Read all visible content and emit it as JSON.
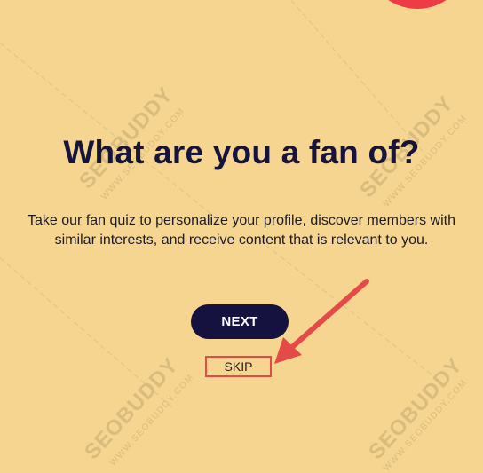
{
  "header": {
    "title": "What are you a fan of?"
  },
  "main": {
    "description": "Take our fan quiz to personalize your profile, discover members with similar interests, and receive content that is relevant to you."
  },
  "actions": {
    "next_label": "NEXT",
    "skip_label": "SKIP"
  },
  "watermark": {
    "brand": "SEOBUDDY",
    "domain": "WWW.SEOBUDDY.COM"
  },
  "colors": {
    "background": "#f5d58f",
    "title": "#16133c",
    "button": "#16123f",
    "accent_red": "#ef3b46",
    "annotation": "#e44a47"
  }
}
